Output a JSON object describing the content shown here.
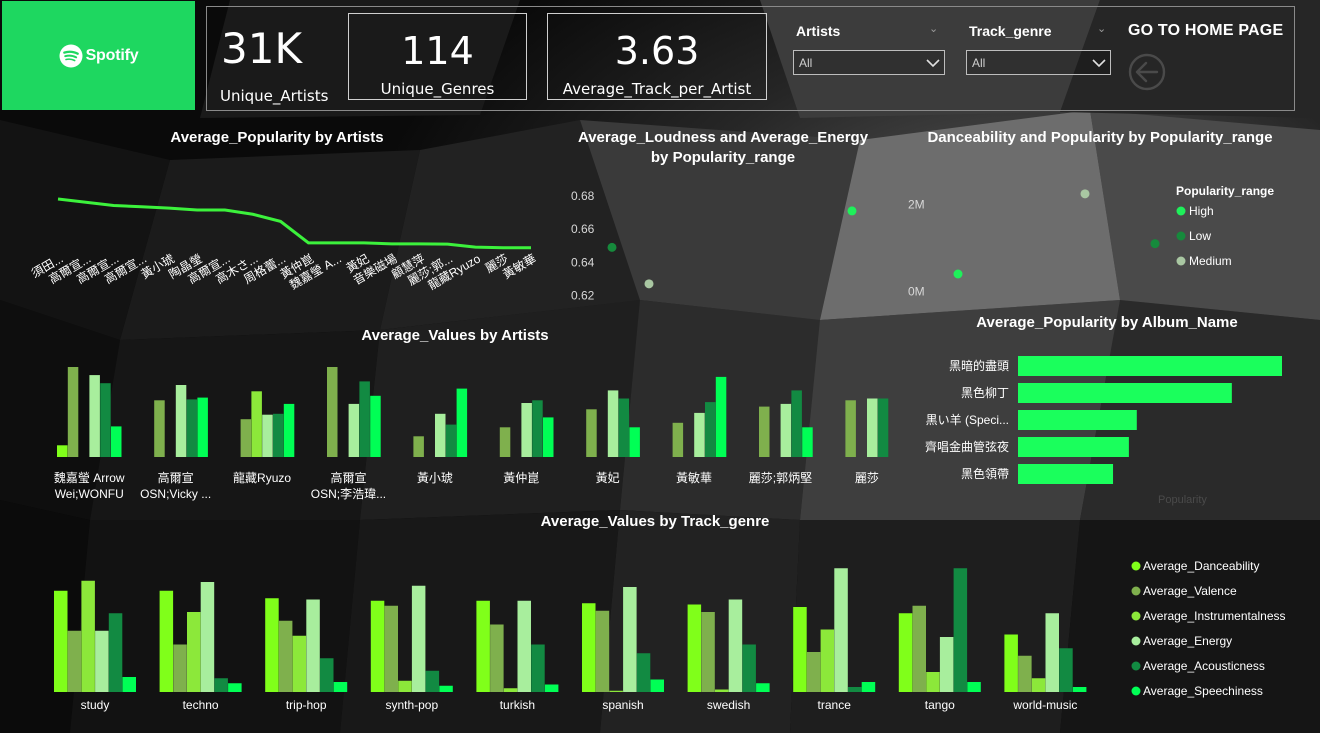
{
  "logo": {
    "text": "Spotify",
    "icon": "spotify-icon"
  },
  "kpis": [
    {
      "value": "31K",
      "label": "Unique_Artists"
    },
    {
      "value": "114",
      "label": "Unique_Genres"
    },
    {
      "value": "3.63",
      "label": "Average_Track_per_Artist"
    }
  ],
  "slicers": {
    "artists": {
      "title": "Artists",
      "value": "All"
    },
    "genre": {
      "title": "Track_genre",
      "value": "All"
    }
  },
  "home": {
    "title": "GO TO HOME PAGE",
    "icon": "back-arrow-icon"
  },
  "colors": {
    "brand": "#1ed760",
    "danceability": "#80ff1a",
    "valence": "#7fb04d",
    "instrumentalness": "#8ce83a",
    "energy": "#a8ee9d",
    "acousticness": "#128a42",
    "speechiness": "#00ff55",
    "popularity_line": "#3cf23c",
    "album_bar": "#1aff5c",
    "high": "#1ef05a",
    "low": "#168a3c",
    "medium": "#a9c7a2"
  },
  "chart_data": [
    {
      "id": "popularity_by_artists",
      "type": "line",
      "title": "Average_Popularity by Artists",
      "categories": [
        "須田...",
        "高爾宣...",
        "高爾宣...",
        "高爾宣...",
        "黃小琥",
        "陶晶瑩",
        "高爾宣...",
        "高木さ...",
        "周格蕾...",
        "黃仲崑",
        "魏嘉瑩 A...",
        "黃妃",
        "音樂磁場",
        "顧慧萍",
        "麗莎;郭...",
        "龍藏Ryuzo",
        "麗莎",
        "黃敏華"
      ],
      "values": [
        92,
        91,
        90,
        89.6,
        89.2,
        88.6,
        88.6,
        87.3,
        85.1,
        78.5,
        78.5,
        78.5,
        78.2,
        78.2,
        78.1,
        77.2,
        77.0,
        77.0
      ],
      "ylim": [
        60,
        100
      ]
    },
    {
      "id": "loudness_energy_by_popularity_range",
      "type": "scatter",
      "title": "Average_Loudness and Average_Energy by Popularity_range",
      "yticks": [
        "0.68",
        "0.66",
        "0.64",
        "0.62"
      ],
      "ylim": [
        0.61,
        0.68
      ],
      "points": [
        {
          "series": "Low",
          "x": 1,
          "y": 0.649
        },
        {
          "series": "Medium",
          "x": 2,
          "y": 0.627
        },
        {
          "series": "High",
          "x": 3,
          "y": 0.671
        }
      ]
    },
    {
      "id": "danceability_popularity_by_popularity_range",
      "type": "scatter",
      "title": "Danceability and Popularity by Popularity_range",
      "yticks": [
        "2M",
        "0M"
      ],
      "ylim": [
        -0.2,
        2.5
      ],
      "legend_title": "Popularity_range",
      "legend": [
        "High",
        "Low",
        "Medium"
      ],
      "legend_position": "right",
      "points": [
        {
          "series": "High",
          "x": 1,
          "y": 0.4
        },
        {
          "series": "Medium",
          "x": 2,
          "y": 2.25
        },
        {
          "series": "Low",
          "x": 3,
          "y": 1.1
        }
      ]
    },
    {
      "id": "popularity_by_album_name",
      "type": "bar",
      "orientation": "horizontal",
      "title": "Average_Popularity by Album_Name",
      "categories": [
        "黑暗的盡頭",
        "黑色柳丁",
        "黒い羊 (Speci...",
        "齊唱金曲管弦夜",
        "黑色領帶"
      ],
      "values": [
        100,
        81,
        45,
        42,
        36
      ],
      "xlim": [
        0,
        100
      ],
      "faint_axis_label": "Popularity"
    },
    {
      "id": "values_by_artists",
      "type": "bar",
      "title": "Average_Values by Artists",
      "categories": [
        [
          "魏嘉瑩 Arrow",
          "Wei;WONFU"
        ],
        [
          "高爾宣",
          "OSN;Vicky ..."
        ],
        [
          "龍藏Ryuzo"
        ],
        [
          "高爾宣",
          "OSN;李浩瑋..."
        ],
        [
          "黃小琥"
        ],
        [
          "黃仲崑"
        ],
        [
          "黃妃"
        ],
        [
          "黃敏華"
        ],
        [
          "麗莎;郭炳堅"
        ],
        [
          "麗莎"
        ]
      ],
      "ylim": [
        0,
        1
      ],
      "series": [
        {
          "name": "Average_Danceability",
          "values": [
            0.13,
            0.0,
            0.0,
            0.0,
            0.0,
            0.0,
            0.0,
            0.0,
            0.0,
            0.0
          ]
        },
        {
          "name": "Average_Valence",
          "values": [
            1.0,
            0.63,
            0.42,
            1.0,
            0.23,
            0.33,
            0.53,
            0.38,
            0.56,
            0.63
          ]
        },
        {
          "name": "Average_Instrumentalness",
          "values": [
            0.0,
            0.0,
            0.73,
            0.0,
            0.0,
            0.0,
            0.0,
            0.0,
            0.0,
            0.0
          ]
        },
        {
          "name": "Average_Energy",
          "values": [
            0.91,
            0.8,
            0.47,
            0.59,
            0.48,
            0.6,
            0.74,
            0.49,
            0.59,
            0.65
          ]
        },
        {
          "name": "Average_Acousticness",
          "values": [
            0.82,
            0.64,
            0.48,
            0.84,
            0.36,
            0.63,
            0.65,
            0.61,
            0.74,
            0.65
          ]
        },
        {
          "name": "Average_Speechiness",
          "values": [
            0.34,
            0.66,
            0.59,
            0.68,
            0.76,
            0.44,
            0.33,
            0.89,
            0.33,
            0.0
          ]
        }
      ]
    },
    {
      "id": "values_by_track_genre",
      "type": "bar",
      "title": "Average_Values by Track_genre",
      "categories": [
        "study",
        "techno",
        "trip-hop",
        "synth-pop",
        "turkish",
        "spanish",
        "swedish",
        "trance",
        "tango",
        "world-music"
      ],
      "ylim": [
        0,
        1
      ],
      "legend": [
        "Average_Danceability",
        "Average_Valence",
        "Average_Instrumentalness",
        "Average_Energy",
        "Average_Acousticness",
        "Average_Speechiness"
      ],
      "legend_position": "right",
      "series": [
        {
          "name": "Average_Danceability",
          "values": [
            0.81,
            0.81,
            0.75,
            0.73,
            0.73,
            0.71,
            0.7,
            0.68,
            0.63,
            0.46
          ]
        },
        {
          "name": "Average_Valence",
          "values": [
            0.49,
            0.38,
            0.57,
            0.69,
            0.54,
            0.65,
            0.64,
            0.32,
            0.69,
            0.29
          ]
        },
        {
          "name": "Average_Instrumentalness",
          "values": [
            0.89,
            0.64,
            0.45,
            0.09,
            0.03,
            0.01,
            0.02,
            0.5,
            0.16,
            0.11
          ]
        },
        {
          "name": "Average_Energy",
          "values": [
            0.49,
            0.88,
            0.74,
            0.85,
            0.73,
            0.84,
            0.74,
            0.99,
            0.44,
            0.63
          ]
        },
        {
          "name": "Average_Acousticness",
          "values": [
            0.63,
            0.11,
            0.27,
            0.17,
            0.38,
            0.31,
            0.38,
            0.04,
            0.99,
            0.35
          ]
        },
        {
          "name": "Average_Speechiness",
          "values": [
            0.12,
            0.07,
            0.08,
            0.05,
            0.06,
            0.1,
            0.07,
            0.08,
            0.08,
            0.04
          ]
        }
      ]
    }
  ]
}
